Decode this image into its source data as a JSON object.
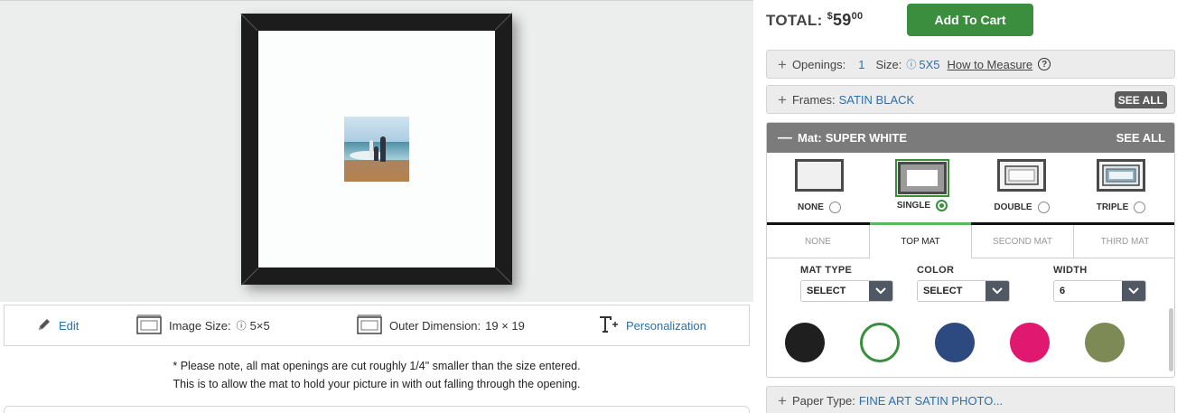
{
  "preview": {
    "toolbar": {
      "edit_label": "Edit",
      "image_size_label": "Image Size:",
      "image_size_value": "5×5",
      "outer_dimension_label": "Outer Dimension:",
      "outer_dimension_value": "19 × 19",
      "personalization_label": "Personalization"
    },
    "note_line1": "* Please note, all mat openings are cut roughly 1/4\" smaller than the size entered.",
    "note_line2": "This is to allow the mat to hold your picture in with out falling through the opening."
  },
  "order": {
    "total_label": "TOTAL:",
    "currency": "$",
    "price_whole": "59",
    "price_cents": "00",
    "add_to_cart_label": "Add To Cart"
  },
  "openings": {
    "label": "Openings:",
    "count": "1",
    "size_label": "Size:",
    "size_value": "5X5",
    "how_to_measure": "How to Measure"
  },
  "frames": {
    "label": "Frames:",
    "value": "SATIN BLACK",
    "see_all": "SEE ALL"
  },
  "mat": {
    "header_label": "Mat:",
    "header_value": "SUPER WHITE",
    "see_all": "SEE ALL",
    "styles": [
      {
        "label": "NONE",
        "selected": false
      },
      {
        "label": "SINGLE",
        "selected": true
      },
      {
        "label": "DOUBLE",
        "selected": false
      },
      {
        "label": "TRIPLE",
        "selected": false
      }
    ],
    "tabs": [
      {
        "label": "NONE",
        "active": false
      },
      {
        "label": "TOP MAT",
        "active": true
      },
      {
        "label": "SECOND MAT",
        "active": false
      },
      {
        "label": "THIRD MAT",
        "active": false
      }
    ],
    "fields": {
      "mat_type_label": "MAT TYPE",
      "mat_type_value": "SELECT",
      "color_label": "COLOR",
      "color_value": "SELECT",
      "width_label": "WIDTH",
      "width_value": "6"
    },
    "swatches": [
      {
        "color": "#1f1f1f",
        "selected": false
      },
      {
        "color": "#ffffff",
        "selected": true
      },
      {
        "color": "#2c4a80",
        "selected": false
      },
      {
        "color": "#e0186f",
        "selected": false
      },
      {
        "color": "#7e8a55",
        "selected": false
      }
    ]
  },
  "paper": {
    "label": "Paper Type:",
    "value": "FINE ART SATIN PHOTO..."
  },
  "colors": {
    "accent_green": "#3a8e3e",
    "link_blue": "#2f6fa6",
    "frame_black": "#1c1c1c"
  }
}
